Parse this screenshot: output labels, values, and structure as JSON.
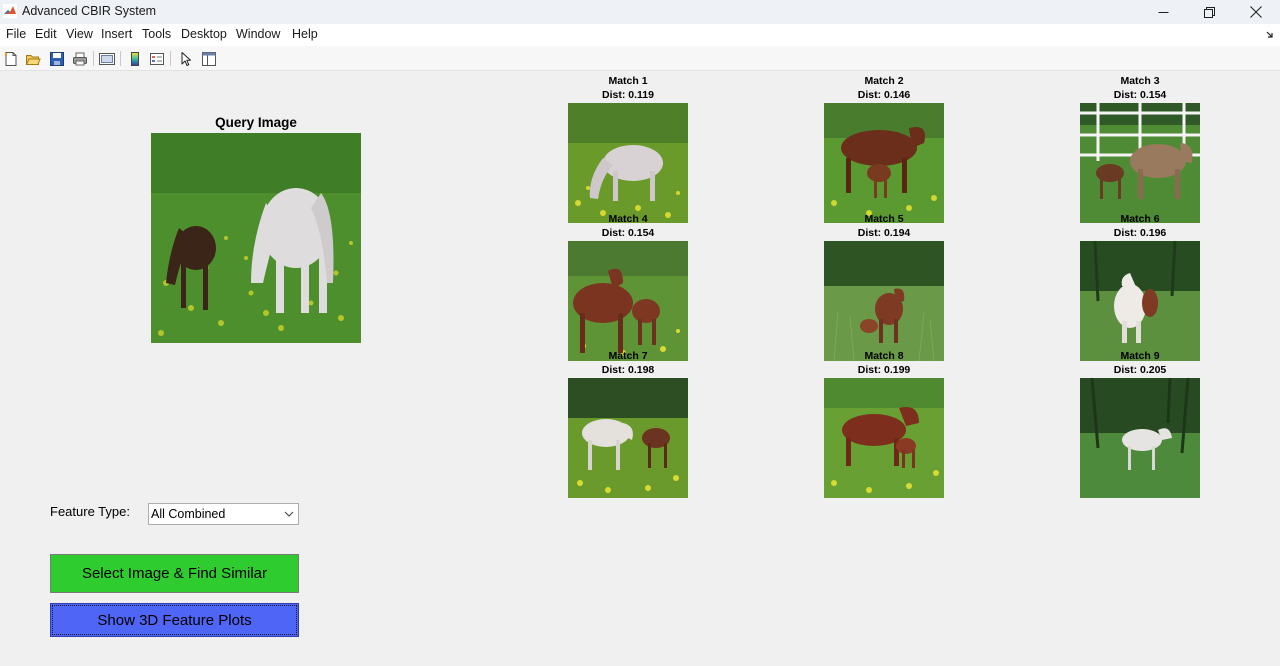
{
  "window": {
    "title": "Advanced CBIR System"
  },
  "menu": [
    {
      "label": "File"
    },
    {
      "label": "Edit"
    },
    {
      "label": "View"
    },
    {
      "label": "Insert"
    },
    {
      "label": "Tools"
    },
    {
      "label": "Desktop"
    },
    {
      "label": "Window"
    },
    {
      "label": "Help"
    }
  ],
  "toolbar": {
    "icons": [
      "new-figure-icon",
      "open-file-icon",
      "save-icon",
      "print-icon",
      "link-plot-icon",
      "colorbar-icon",
      "legend-icon",
      "edit-plot-pointer-icon",
      "property-inspector-icon"
    ]
  },
  "query": {
    "title": "Query Image",
    "thumbnail": "grass-horses-gray-brown"
  },
  "matches": [
    {
      "title": "Match 1",
      "dist": "Dist: 0.119",
      "thumbnail": "gray-horse-grazing"
    },
    {
      "title": "Match 2",
      "dist": "Dist: 0.146",
      "thumbnail": "brown-mare-and-foal"
    },
    {
      "title": "Match 3",
      "dist": "Dist: 0.154",
      "thumbnail": "horses-white-fence"
    },
    {
      "title": "Match 4",
      "dist": "Dist: 0.154",
      "thumbnail": "chestnut-mare-and-foal"
    },
    {
      "title": "Match 5",
      "dist": "Dist: 0.194",
      "thumbnail": "horses-in-tall-grass"
    },
    {
      "title": "Match 6",
      "dist": "Dist: 0.196",
      "thumbnail": "white-horse-in-woods"
    },
    {
      "title": "Match 7",
      "dist": "Dist: 0.198",
      "thumbnail": "white-horse-and-foal"
    },
    {
      "title": "Match 8",
      "dist": "Dist: 0.199",
      "thumbnail": "chestnut-horse-and-foal"
    },
    {
      "title": "Match 9",
      "dist": "Dist: 0.205",
      "thumbnail": "white-horse-forest-clearing"
    }
  ],
  "controls": {
    "feature_label": "Feature Type:",
    "feature_value": "All Combined",
    "select_button": "Select Image & Find Similar",
    "plots_button": "Show 3D Feature Plots"
  },
  "colors": {
    "select_button": "#2ecc2e",
    "plots_button": "#4f65f5",
    "background": "#f0f0f0"
  }
}
